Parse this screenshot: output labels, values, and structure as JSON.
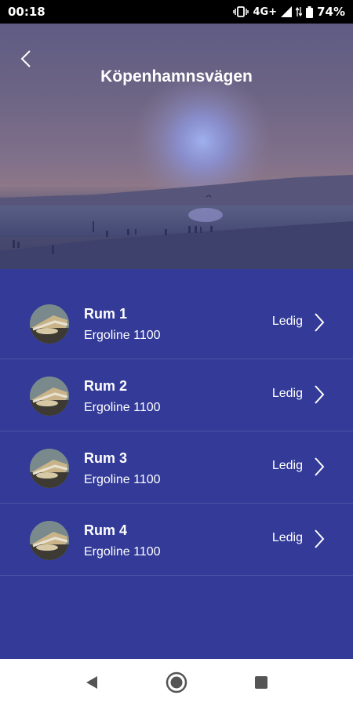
{
  "status_bar": {
    "time": "00:18",
    "network": "4G+",
    "battery": "74%"
  },
  "header": {
    "title": "Köpenhamnsvägen",
    "back_icon": "chevron-left-icon"
  },
  "rooms": [
    {
      "name": "Rum 1",
      "model": "Ergoline 1100",
      "status": "Ledig"
    },
    {
      "name": "Rum 2",
      "model": "Ergoline 1100",
      "status": "Ledig"
    },
    {
      "name": "Rum 3",
      "model": "Ergoline 1100",
      "status": "Ledig"
    },
    {
      "name": "Rum 4",
      "model": "Ergoline 1100",
      "status": "Ledig"
    }
  ],
  "nav": {
    "back_icon": "triangle-back-icon",
    "home_icon": "circle-home-icon",
    "recents_icon": "square-recents-icon"
  },
  "colors": {
    "list_background": "#333a98",
    "status_bar": "#000000",
    "nav_background": "#ffffff",
    "text": "#ffffff"
  }
}
